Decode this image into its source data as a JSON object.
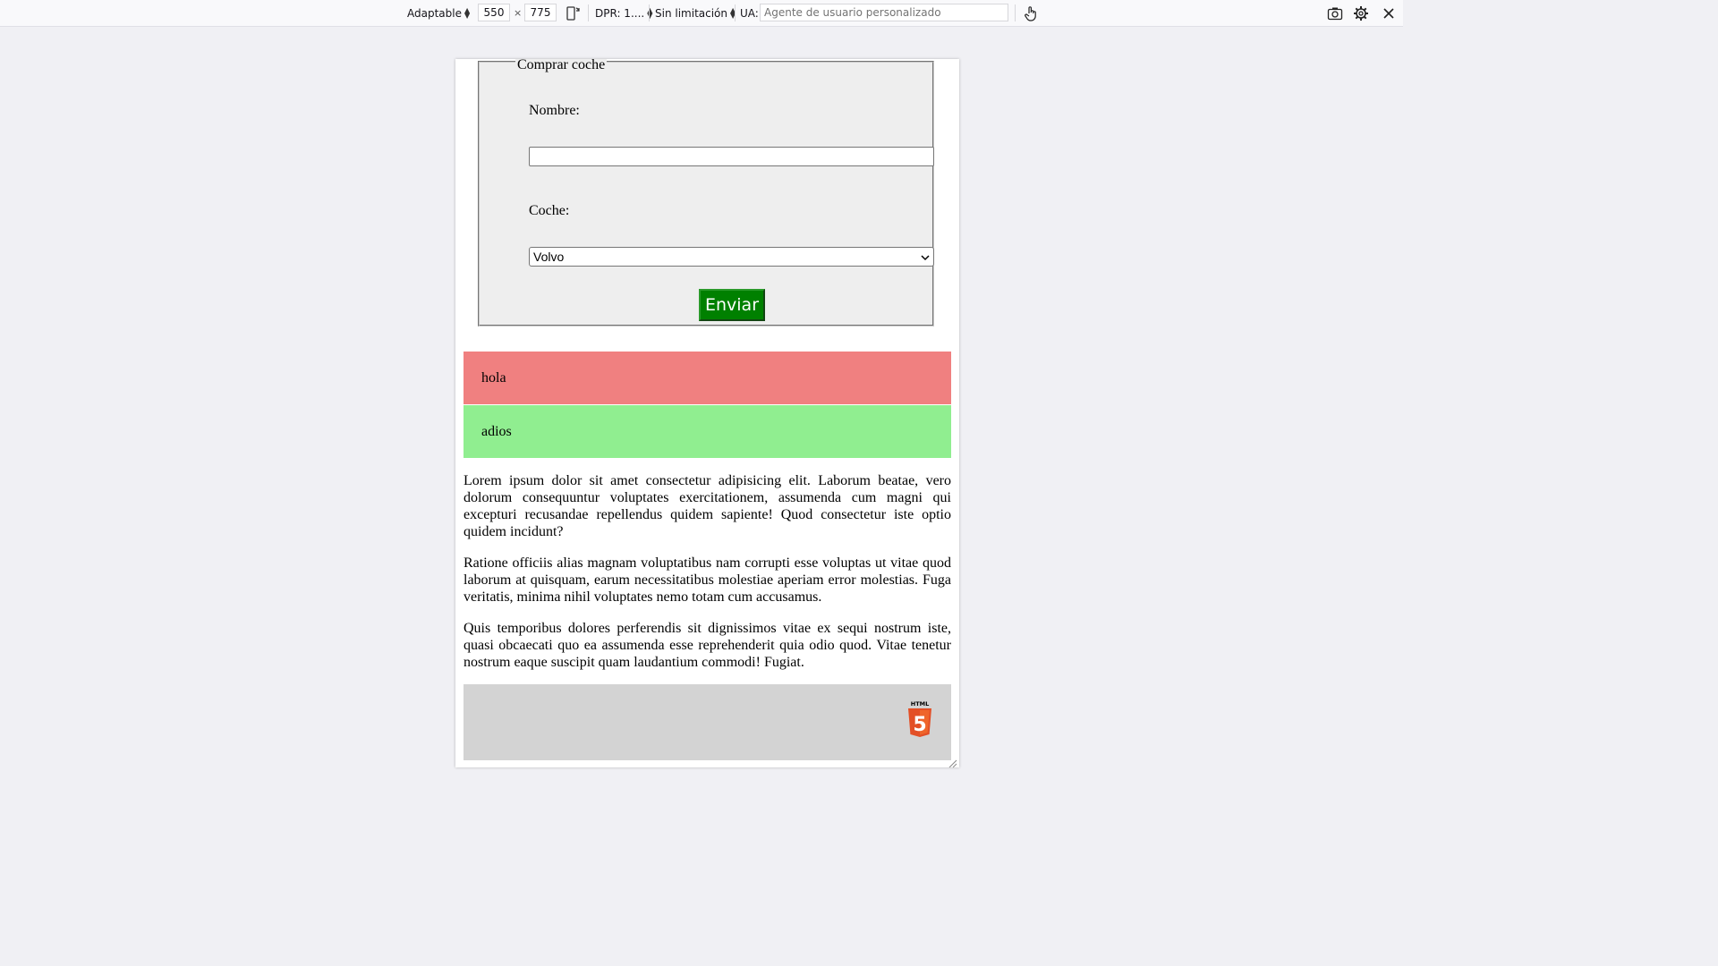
{
  "toolbar": {
    "device_label": "Adaptable",
    "width_value": "550",
    "times": "×",
    "height_value": "775",
    "dpr_label": "DPR: 1....",
    "throttle_label": "Sin limitación",
    "ua_label": "UA:",
    "ua_placeholder": "Agente de usuario personalizado"
  },
  "form": {
    "legend": "Comprar coche",
    "name_label": "Nombre:",
    "name_value": "",
    "car_label": "Coche:",
    "car_selected": "Volvo",
    "submit_label": "Enviar"
  },
  "boxes": {
    "red_text": "hola",
    "green_text": "adios",
    "red_color": "#f08080",
    "green_color": "#90ee90"
  },
  "paragraphs": [
    "Lorem ipsum dolor sit amet consectetur adipisicing elit. Laborum beatae, vero dolorum consequuntur voluptates exercitationem, assumenda cum magni qui excepturi recusandae repellendus quidem sapiente! Quod consectetur iste optio quidem incidunt?",
    "Ratione officiis alias magnam voluptatibus nam corrupti esse voluptas ut vitae quod laborum at quisquam, earum necessitatibus molestiae aperiam error molestias. Fuga veritatis, minima nihil voluptates nemo totam cum accusamus.",
    "Quis temporibus dolores perferendis sit dignissimos vitae ex sequi nostrum iste, quasi obcaecati quo ea assumenda esse reprehenderit quia odio quod. Vitae tenetur nostrum eaque suscipit quam laudantium commodi! Fugiat."
  ],
  "footer": {
    "logo_text": "HTML",
    "logo_digit": "5",
    "logo_color": "#e34f26"
  },
  "icons": {
    "rotate": "rotate-icon",
    "touch": "touch-icon",
    "screenshot": "camera-icon",
    "settings": "gear-icon",
    "close": "close-icon"
  }
}
